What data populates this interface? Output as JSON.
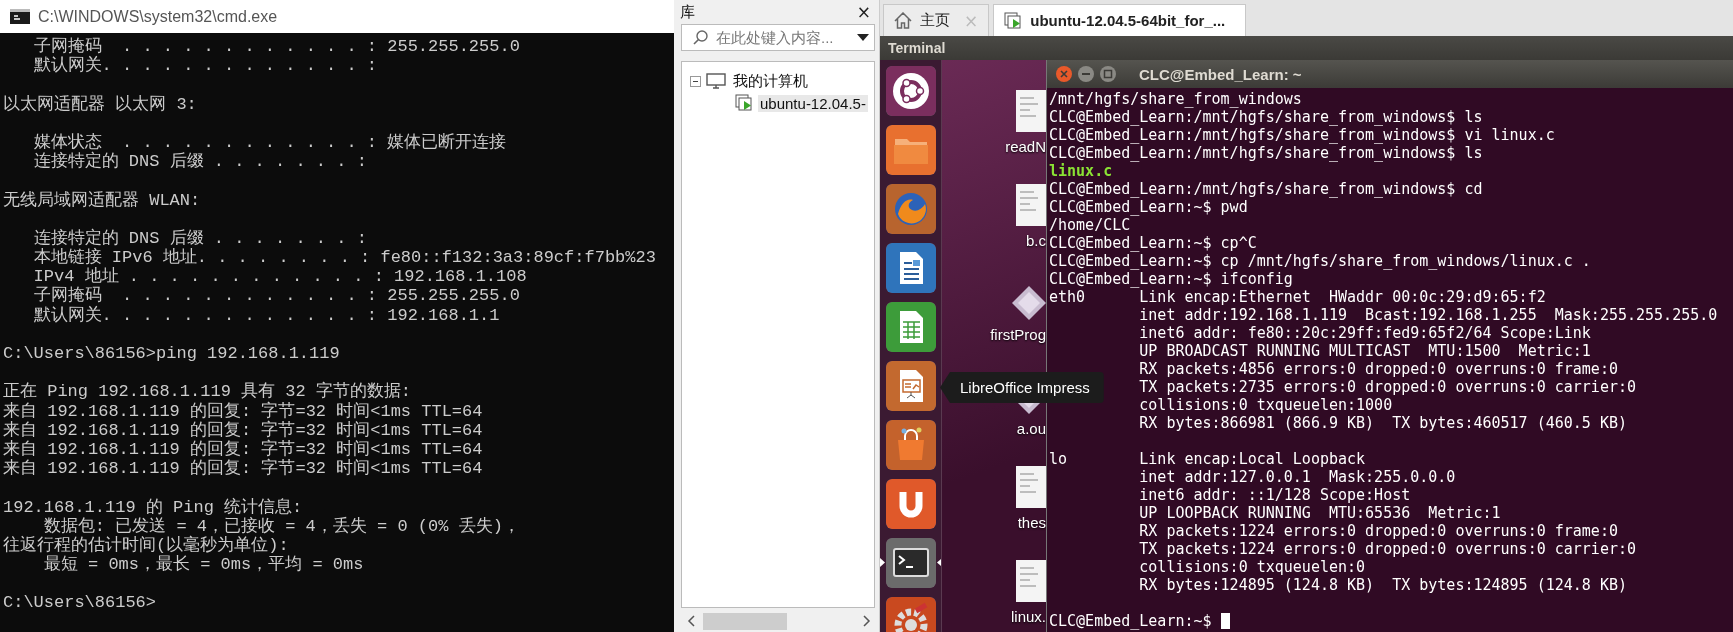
{
  "cmd_window": {
    "title": "C:\\WINDOWS\\system32\\cmd.exe",
    "blocks": [
      [
        "   子网掩码  . . . . . . . . . . . . : 255.255.255.0",
        "   默认网关. . . . . . . . . . . . . :"
      ],
      [
        "以太网适配器 以太网 3:"
      ],
      [
        "   媒体状态  . . . . . . . . . . . . : 媒体已断开连接",
        "   连接特定的 DNS 后缀 . . . . . . . :"
      ],
      [
        "无线局域网适配器 WLAN:"
      ],
      [
        "   连接特定的 DNS 后缀 . . . . . . . :",
        "   本地链接 IPv6 地址. . . . . . . . : fe80::f132:3a3:89cf:f7bb%23",
        "   IPv4 地址 . . . . . . . . . . . . : 192.168.1.108",
        "   子网掩码  . . . . . . . . . . . . : 255.255.255.0",
        "   默认网关. . . . . . . . . . . . . : 192.168.1.1"
      ],
      [
        "C:\\Users\\86156>ping 192.168.1.119"
      ],
      [
        "正在 Ping 192.168.1.119 具有 32 字节的数据:",
        "来自 192.168.1.119 的回复: 字节=32 时间<1ms TTL=64",
        "来自 192.168.1.119 的回复: 字节=32 时间<1ms TTL=64",
        "来自 192.168.1.119 的回复: 字节=32 时间<1ms TTL=64",
        "来自 192.168.1.119 的回复: 字节=32 时间<1ms TTL=64"
      ],
      [
        "192.168.1.119 的 Ping 统计信息:",
        "    数据包: 已发送 = 4，已接收 = 4，丢失 = 0 (0% 丢失)，",
        "往返行程的估计时间(以毫秒为单位):",
        "    最短 = 0ms，最长 = 0ms，平均 = 0ms"
      ],
      [
        "C:\\Users\\86156>"
      ]
    ]
  },
  "library": {
    "title": "库",
    "close": "×",
    "search": {
      "placeholder": "在此处键入内容..."
    },
    "tree": [
      {
        "label": "我的计算机",
        "expanded": true,
        "children": [
          {
            "label": "ubuntu-12.04.5-",
            "selected": true
          }
        ]
      }
    ]
  },
  "tabs": [
    {
      "kind": "home",
      "label": "主页",
      "close": "×",
      "selected": false
    },
    {
      "kind": "vm",
      "label": "ubuntu-12.04.5-64bit_for_...",
      "selected": true
    }
  ],
  "vm_screen": {
    "top_bar": "Terminal",
    "launcher": [
      {
        "kind": "dash",
        "active": false
      },
      {
        "kind": "files",
        "active": false
      },
      {
        "kind": "firefox",
        "active": false
      },
      {
        "kind": "writer",
        "active": false
      },
      {
        "kind": "calc",
        "active": false
      },
      {
        "kind": "impress",
        "active": false
      },
      {
        "kind": "software",
        "active": false
      },
      {
        "kind": "ubuntu_one",
        "active": false
      },
      {
        "kind": "terminal",
        "active": true
      },
      {
        "kind": "settings",
        "active": false
      }
    ],
    "desktop_files": [
      {
        "kind": "document",
        "label": "readN"
      },
      {
        "kind": "document",
        "label": "b.c"
      },
      {
        "kind": "program",
        "label": "firstProg"
      },
      {
        "kind": "program",
        "label": "a.ou"
      },
      {
        "kind": "document",
        "label": "thes"
      },
      {
        "kind": "document",
        "label": "linux."
      }
    ],
    "tooltip": "LibreOffice Impress",
    "terminal": {
      "title": "CLC@Embed_Learn: ~",
      "blocks": [
        [
          {
            "kind": "plain",
            "text": "/mnt/hgfs/share_from_windows"
          },
          {
            "kind": "plain",
            "text": "CLC@Embed_Learn:/mnt/hgfs/share_from_windows$ ls"
          },
          {
            "kind": "plain",
            "text": "CLC@Embed_Learn:/mnt/hgfs/share_from_windows$ vi linux.c"
          },
          {
            "kind": "plain",
            "text": "CLC@Embed_Learn:/mnt/hgfs/share_from_windows$ ls"
          },
          {
            "kind": "file",
            "text": "linux.c"
          },
          {
            "kind": "plain",
            "text": "CLC@Embed_Learn:/mnt/hgfs/share_from_windows$ cd"
          },
          {
            "kind": "plain",
            "text": "CLC@Embed_Learn:~$ pwd"
          },
          {
            "kind": "plain",
            "text": "/home/CLC"
          },
          {
            "kind": "plain",
            "text": "CLC@Embed_Learn:~$ cp^C"
          },
          {
            "kind": "plain",
            "text": "CLC@Embed_Learn:~$ cp /mnt/hgfs/share_from_windows/linux.c ."
          },
          {
            "kind": "plain",
            "text": "CLC@Embed_Learn:~$ ifconfig"
          },
          {
            "kind": "plain",
            "text": "eth0      Link encap:Ethernet  HWaddr 00:0c:29:d9:65:f2"
          },
          {
            "kind": "plain",
            "text": "          inet addr:192.168.1.119  Bcast:192.168.1.255  Mask:255.255.255.0"
          },
          {
            "kind": "plain",
            "text": "          inet6 addr: fe80::20c:29ff:fed9:65f2/64 Scope:Link"
          },
          {
            "kind": "plain",
            "text": "          UP BROADCAST RUNNING MULTICAST  MTU:1500  Metric:1"
          },
          {
            "kind": "plain",
            "text": "          RX packets:4856 errors:0 dropped:0 overruns:0 frame:0"
          },
          {
            "kind": "plain",
            "text": "          TX packets:2735 errors:0 dropped:0 overruns:0 carrier:0"
          },
          {
            "kind": "plain",
            "text": "          collisions:0 txqueuelen:1000"
          },
          {
            "kind": "plain",
            "text": "          RX bytes:866981 (866.9 KB)  TX bytes:460517 (460.5 KB)"
          }
        ],
        [
          {
            "kind": "plain",
            "text": "lo        Link encap:Local Loopback"
          },
          {
            "kind": "plain",
            "text": "          inet addr:127.0.0.1  Mask:255.0.0.0"
          },
          {
            "kind": "plain",
            "text": "          inet6 addr: ::1/128 Scope:Host"
          },
          {
            "kind": "plain",
            "text": "          UP LOOPBACK RUNNING  MTU:65536  Metric:1"
          },
          {
            "kind": "plain",
            "text": "          RX packets:1224 errors:0 dropped:0 overruns:0 frame:0"
          },
          {
            "kind": "plain",
            "text": "          TX packets:1224 errors:0 dropped:0 overruns:0 carrier:0"
          },
          {
            "kind": "plain",
            "text": "          collisions:0 txqueuelen:0"
          },
          {
            "kind": "plain",
            "text": "          RX bytes:124895 (124.8 KB)  TX bytes:124895 (124.8 KB)"
          }
        ],
        [
          {
            "kind": "prompt",
            "text": "CLC@Embed_Learn:~$"
          }
        ]
      ]
    }
  }
}
